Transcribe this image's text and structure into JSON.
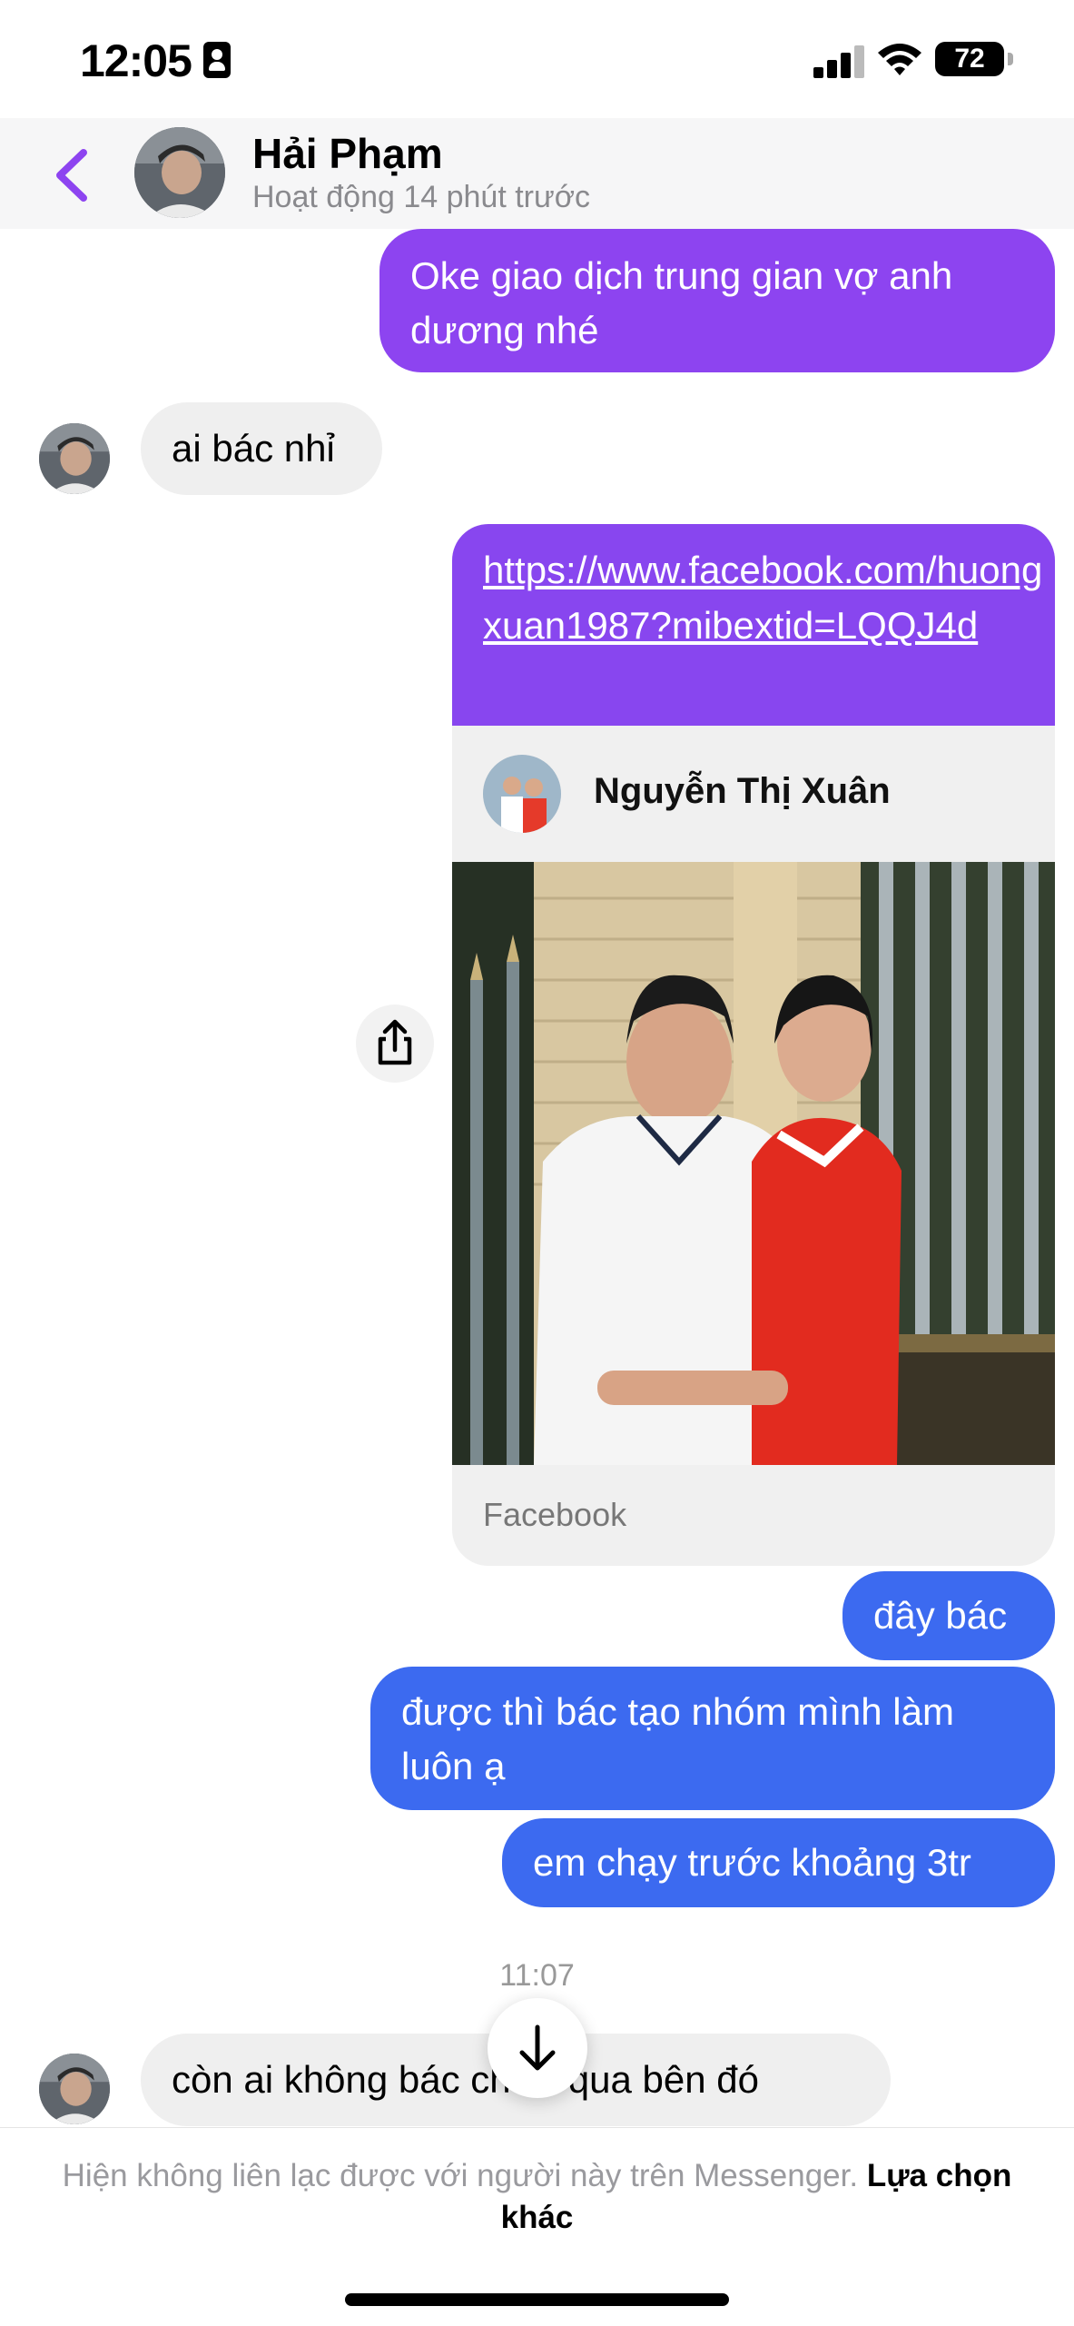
{
  "status_bar": {
    "time": "12:05",
    "battery": "72"
  },
  "header": {
    "contact_name": "Hải Phạm",
    "contact_status": "Hoạt động 14 phút trước",
    "accent_color": "#8d44f0"
  },
  "messages": [
    {
      "text": "Oke giao dịch trung gian vợ anh dương nhé"
    },
    {
      "text": "ai bác nhỉ"
    },
    {
      "text": "https://www.facebook.com/huongxuan1987?mibextid=LQQJ4d"
    },
    {
      "text": "đây bác"
    },
    {
      "text": "được thì bác tạo nhóm mình làm luôn ạ"
    },
    {
      "text": "em chạy trước khoảng 3tr"
    },
    {
      "text": "còn ai không bác chưa qua bên đó"
    }
  ],
  "link_preview": {
    "profile_name": "Nguyễn Thị Xuân",
    "source": "Facebook"
  },
  "timestamp": "11:07",
  "footer": {
    "notice": "Hiện không liên lạc được với người này trên Messenger.",
    "action": "Lựa chọn khác"
  },
  "colors": {
    "outgoing_purple": "#8d44f0",
    "outgoing_blue": "#3c6af0",
    "incoming_gray": "#efefef"
  },
  "icons": [
    "contact-card-icon",
    "signal-icon",
    "wifi-icon",
    "battery-icon",
    "back-chevron-icon",
    "share-icon",
    "arrow-down-icon"
  ]
}
